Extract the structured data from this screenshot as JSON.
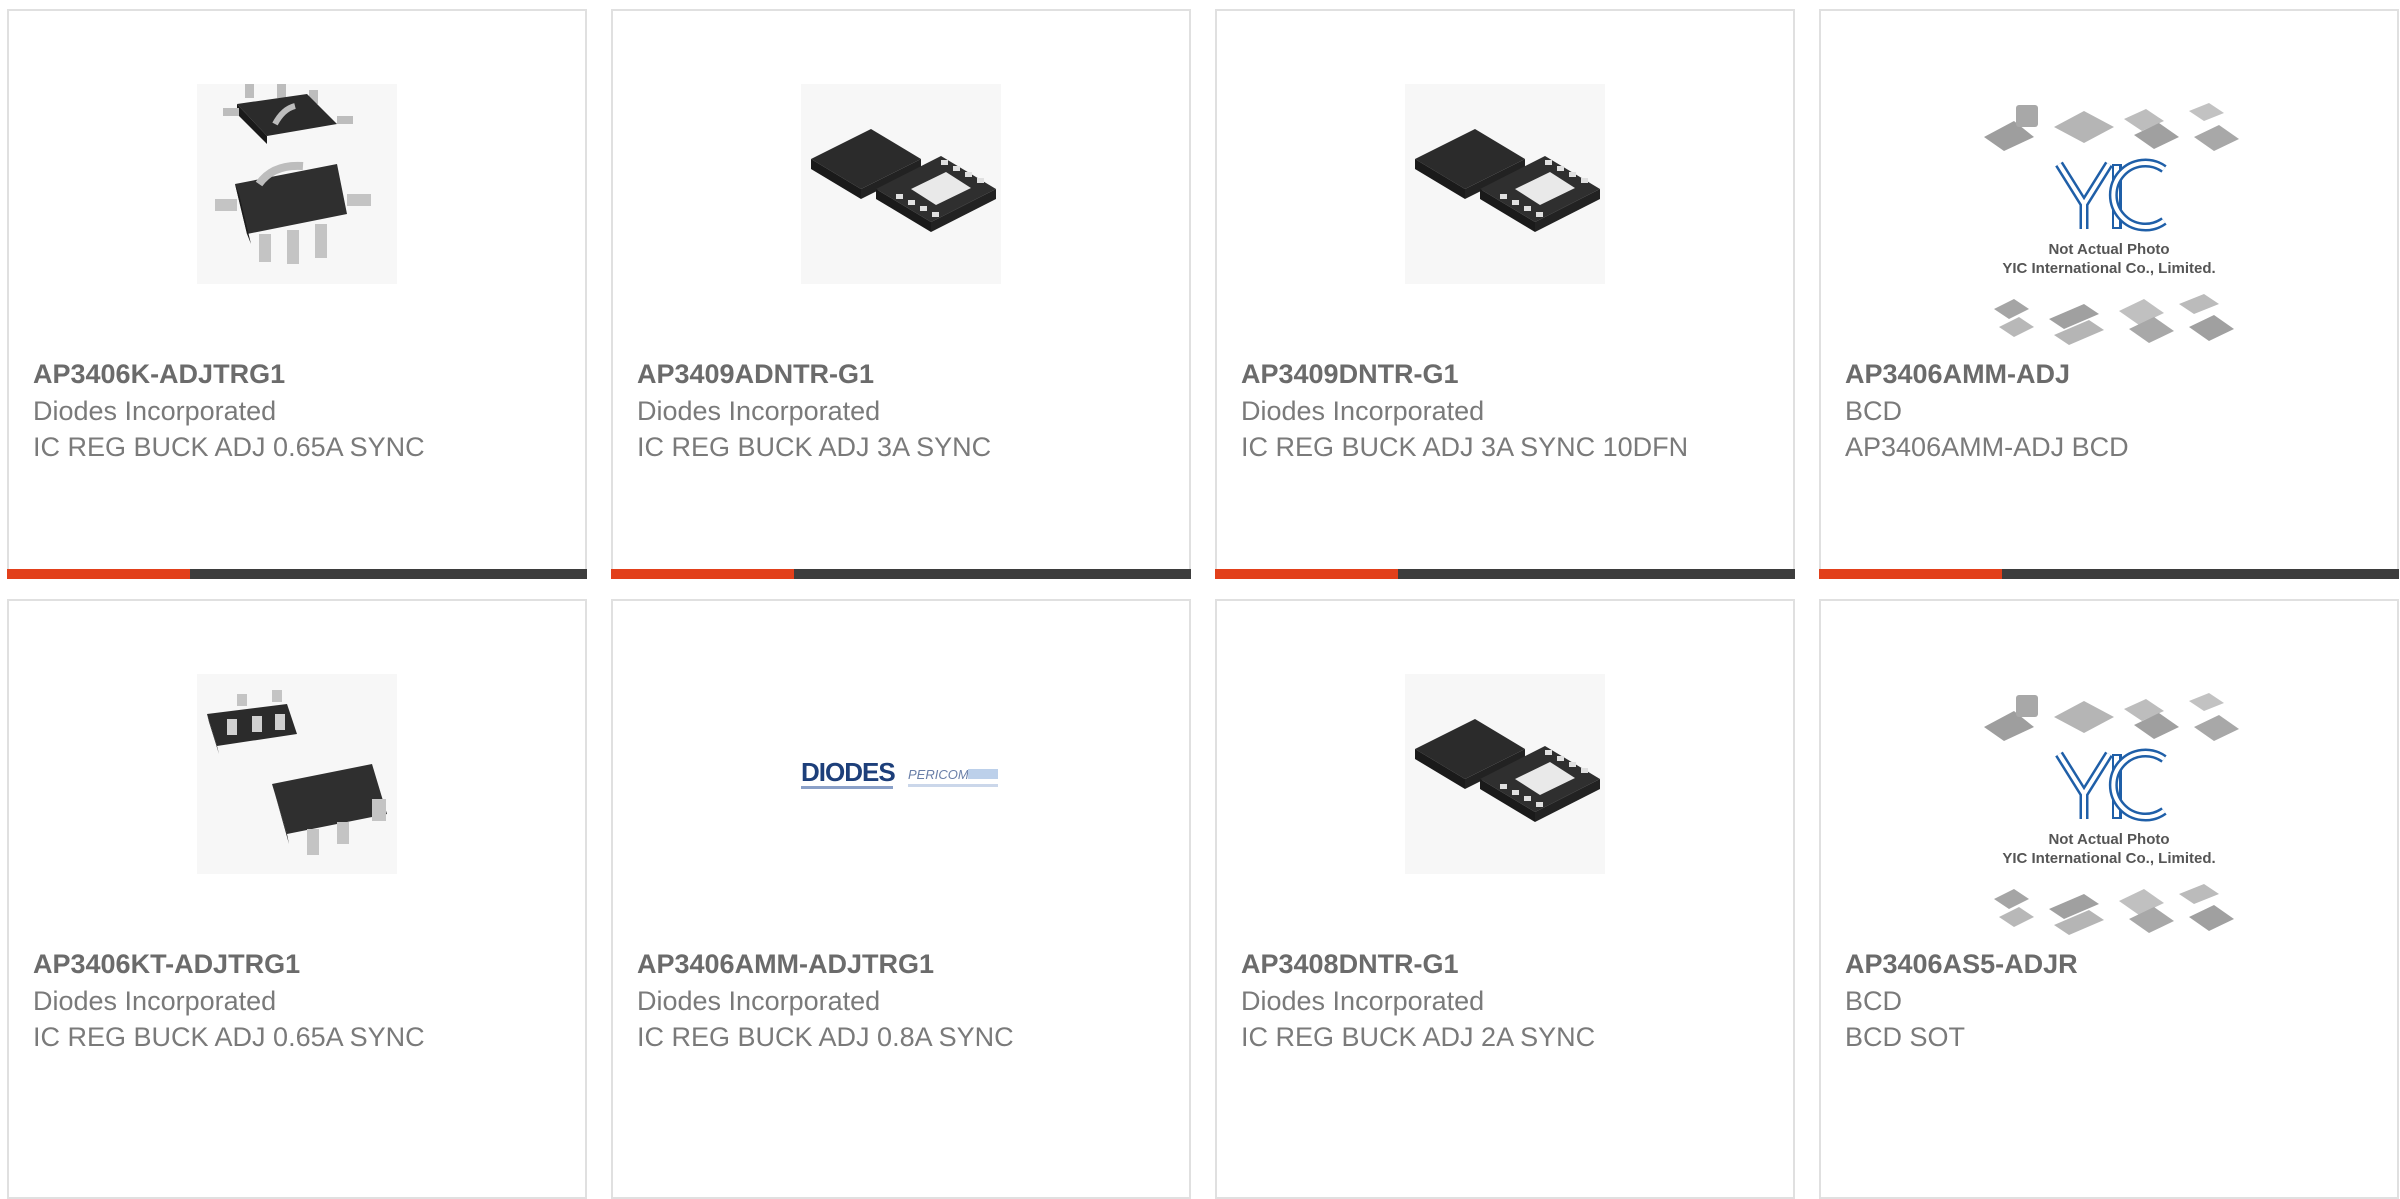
{
  "products": [
    {
      "part_number": "AP3406K-ADJTRG1",
      "manufacturer": "Diodes Incorporated",
      "description": "IC REG BUCK ADJ 0.65A SYNC",
      "image": "sot-package-photo"
    },
    {
      "part_number": "AP3409ADNTR-G1",
      "manufacturer": "Diodes Incorporated",
      "description": "IC REG BUCK ADJ 3A SYNC",
      "image": "dfn-package-photo"
    },
    {
      "part_number": "AP3409DNTR-G1",
      "manufacturer": "Diodes Incorporated",
      "description": "IC REG BUCK ADJ 3A SYNC 10DFN",
      "image": "dfn-package-photo"
    },
    {
      "part_number": "AP3406AMM-ADJ",
      "manufacturer": "BCD",
      "description": "AP3406AMM-ADJ BCD",
      "image": "yic-placeholder",
      "placeholder_lines": [
        "Not Actual Photo",
        "YIC International Co., Limited."
      ]
    },
    {
      "part_number": "AP3406KT-ADJTRG1",
      "manufacturer": "Diodes Incorporated",
      "description": "IC REG BUCK ADJ 0.65A SYNC",
      "image": "sot-package-photo"
    },
    {
      "part_number": "AP3406AMM-ADJTRG1",
      "manufacturer": "Diodes Incorporated",
      "description": "IC REG BUCK ADJ 0.8A SYNC",
      "image": "diodes-pericom-logo",
      "logo_text": [
        "DIODES",
        "PERICOM"
      ]
    },
    {
      "part_number": "AP3408DNTR-G1",
      "manufacturer": "Diodes Incorporated",
      "description": "IC REG BUCK ADJ 2A SYNC",
      "image": "dfn-package-photo"
    },
    {
      "part_number": "AP3406AS5-ADJR",
      "manufacturer": "BCD",
      "description": "BCD SOT",
      "image": "yic-placeholder",
      "placeholder_lines": [
        "Not Actual Photo",
        "YIC International Co., Limited."
      ]
    }
  ],
  "colors": {
    "accent": "#e2401b",
    "bar": "#3d3d3d",
    "border": "#e0e0e0",
    "text_primary": "#6b6b6b",
    "text_secondary": "#7a7a7a"
  }
}
